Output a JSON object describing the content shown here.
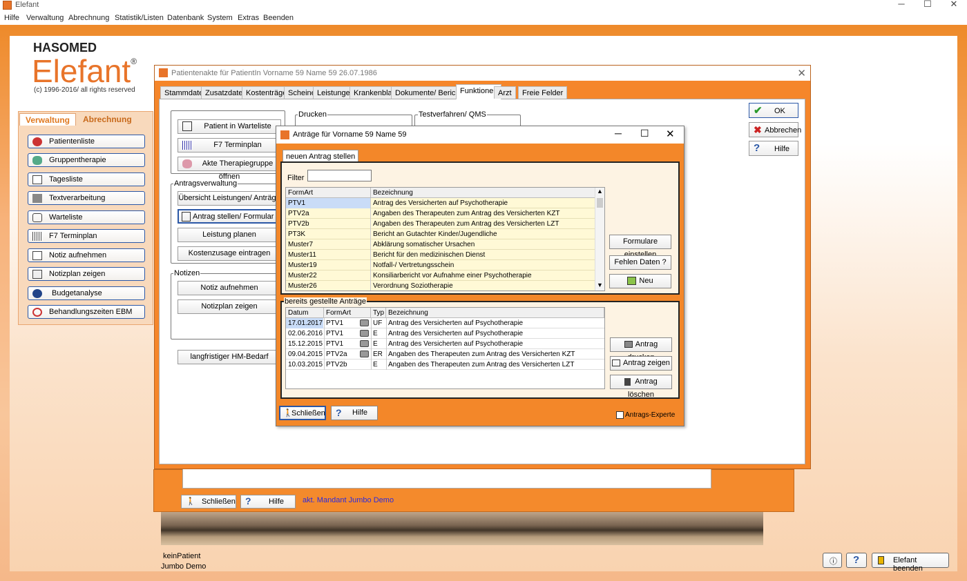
{
  "window": {
    "title": "Elefant"
  },
  "menu": [
    "Hilfe",
    "Verwaltung",
    "Abrechnung",
    "Statistik/Listen",
    "Datenbank",
    "System",
    "Extras",
    "Beenden"
  ],
  "logo": {
    "company": "HASOMED",
    "product": "Elefant",
    "reg": "®",
    "copyright": "(c) 1996-2016/ all rights reserved"
  },
  "nav": {
    "tabs": [
      "Verwaltung",
      "Abrechnung"
    ],
    "items": [
      "Patientenliste",
      "Gruppentherapie",
      "Tagesliste",
      "Textverarbeitung",
      "Warteliste",
      "F7 Terminplan",
      "Notiz aufnehmen",
      "Notizplan zeigen",
      "Budgetanalyse",
      "Behandlungszeiten EBM"
    ]
  },
  "patient_window": {
    "title": "Patientenakte für PatientIn Vorname 59 Name 59 26.07.1986",
    "tabs": [
      "Stammdaten",
      "Zusatzdaten",
      "Kostenträger",
      "Scheine",
      "Leistungen",
      "Krankenblatt",
      "Dokumente/ Berichte",
      "Funktionen",
      "Arzt",
      "Freie Felder"
    ],
    "active_tab": "Funktionen",
    "buttons_top": [
      "Patient in Warteliste",
      "F7 Terminplan",
      "Akte Therapiegruppe öffnen"
    ],
    "group_drucken": "Drucken",
    "group_test": "Testverfahren/ QMS",
    "group_antrag": "Antragsverwaltung",
    "antrag_buttons": [
      "Übersicht Leistungen/ Anträge",
      "Antrag stellen/ Formular nutzen",
      "Leistung planen",
      "Kostenzusage eintragen"
    ],
    "group_notizen": "Notizen",
    "notiz_buttons": [
      "Notiz aufnehmen",
      "Notizplan zeigen"
    ],
    "hm_button": "langfristiger HM-Bedarf",
    "ok": "OK",
    "abbrechen": "Abbrechen",
    "hilfe": "Hilfe"
  },
  "background": {
    "schliessen": "Schließen",
    "hilfe": "Hilfe",
    "mandant": "akt. Mandant Jumbo Demo",
    "status_patient": "keinPatient",
    "status_mandant": "Jumbo Demo",
    "beenden": "Elefant beenden"
  },
  "dialog": {
    "title": "Anträge für Vorname 59 Name 59",
    "tab": "neuen Antrag stellen",
    "filter_label": "Filter",
    "filter_value": "",
    "columns": [
      "FormArt",
      "Bezeichnung"
    ],
    "rows": [
      [
        "PTV1",
        "Antrag des Versicherten auf Psychotherapie"
      ],
      [
        "PTV2a",
        "Angaben des Therapeuten zum Antrag des Versicherten KZT"
      ],
      [
        "PTV2b",
        "Angaben des Therapeuten zum Antrag des Versicherten LZT"
      ],
      [
        "PT3K",
        "Bericht an Gutachter Kinder/Jugendliche"
      ],
      [
        "Muster7",
        "Abklärung somatischer Ursachen"
      ],
      [
        "Muster11",
        "Bericht für den medizinischen Dienst"
      ],
      [
        "Muster19",
        "Notfall-/ Vertretungsschein"
      ],
      [
        "Muster22",
        "Konsiliarbericht vor Aufnahme einer Psychotherapie"
      ],
      [
        "Muster26",
        "Verordnung Soziotherapie"
      ]
    ],
    "side_buttons": [
      "Formulare einstellen",
      "Fehlen Daten ?",
      "Neu"
    ],
    "existing_label": "bereits gestellte Anträge",
    "existing_columns": [
      "Datum",
      "FormArt",
      "Typ",
      "Bezeichnung"
    ],
    "existing_rows": [
      [
        "17.01.2017",
        "PTV1",
        "UF",
        "Antrag des Versicherten auf Psychotherapie"
      ],
      [
        "02.06.2016",
        "PTV1",
        "E",
        "Antrag des Versicherten auf Psychotherapie"
      ],
      [
        "15.12.2015",
        "PTV1",
        "E",
        "Antrag des Versicherten auf Psychotherapie"
      ],
      [
        "09.04.2015",
        "PTV2a",
        "ER",
        "Angaben des Therapeuten zum Antrag des Versicherten KZT"
      ],
      [
        "10.03.2015",
        "PTV2b",
        "E",
        "Angaben des Therapeuten zum Antrag des Versicherten LZT"
      ]
    ],
    "existing_buttons": [
      "Antrag drucken",
      "Antrag zeigen",
      "Antrag löschen"
    ],
    "schliessen": "Schließen",
    "hilfe": "Hilfe",
    "experte": "Antrags-Experte"
  }
}
